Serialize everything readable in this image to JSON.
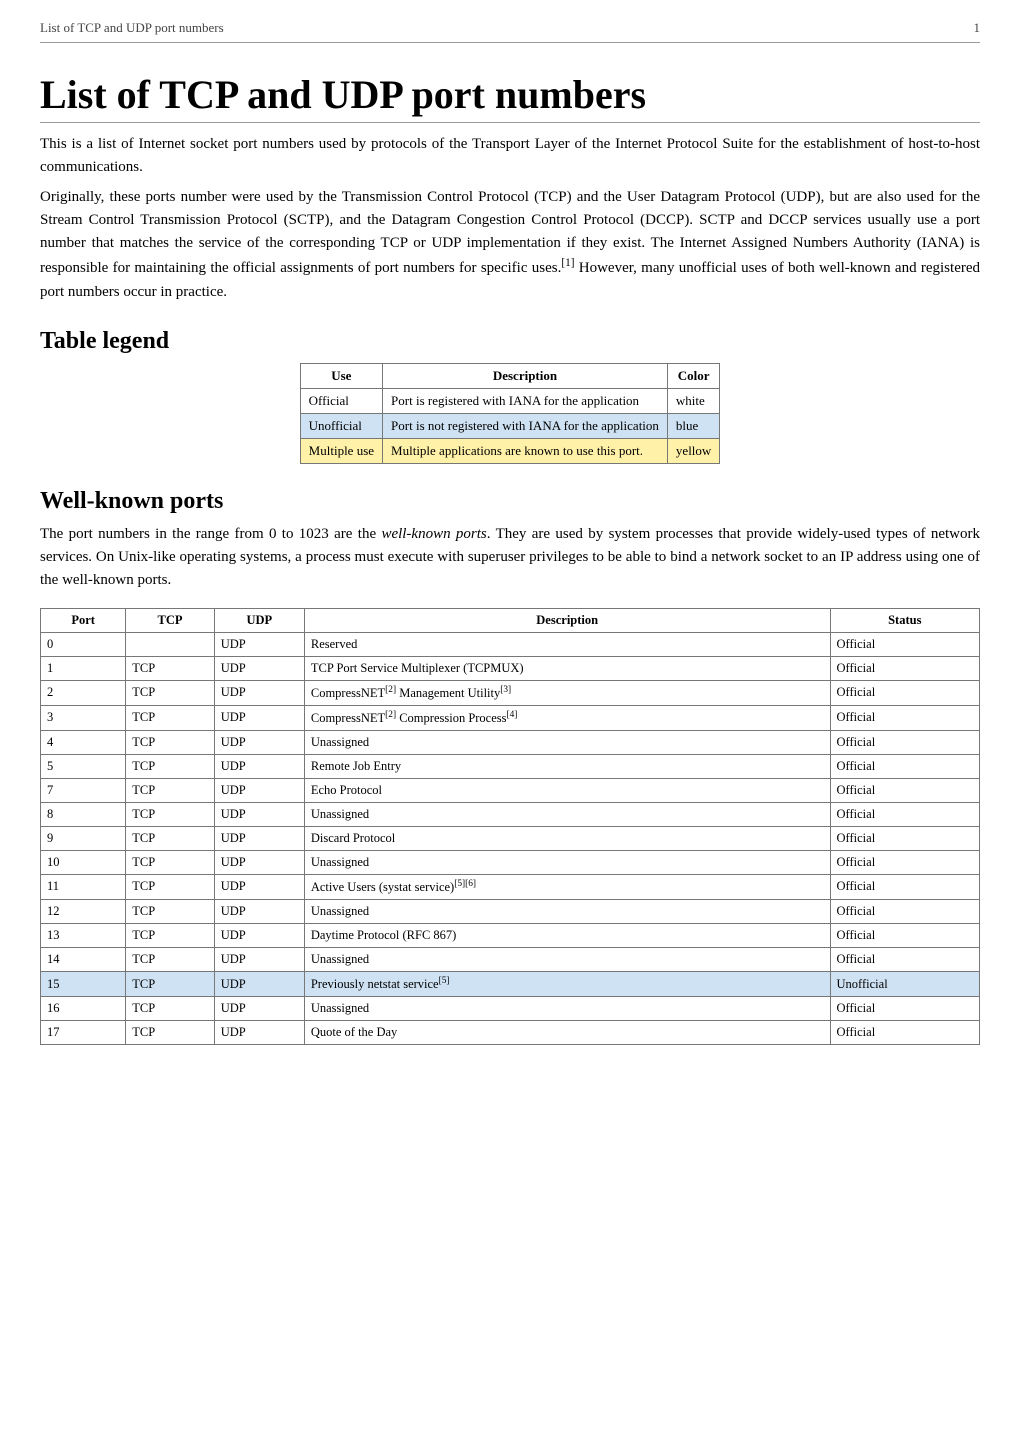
{
  "header": {
    "left": "List of TCP and UDP port numbers",
    "right": "1"
  },
  "title": "List of TCP and UDP port numbers",
  "intro": {
    "p1": "This is a list of Internet socket port numbers used by protocols of the Transport Layer of the Internet Protocol Suite for the establishment of host-to-host communications.",
    "p2_a": "Originally, these ports number were used by the Transmission Control Protocol (TCP) and the User Datagram Protocol (UDP), but are also used for the Stream Control Transmission Protocol (SCTP), and the Datagram Congestion Control Protocol (DCCP). SCTP and DCCP services usually use a port number that matches the service of the corresponding TCP or UDP implementation if they exist. The Internet Assigned Numbers Authority (IANA) is responsible for maintaining the official assignments of port numbers for specific uses.",
    "p2_sup": "[1]",
    "p2_b": " However, many unofficial uses of both well-known and registered port numbers occur in practice."
  },
  "legend": {
    "heading": "Table legend",
    "cols": {
      "use": "Use",
      "desc": "Description",
      "color": "Color"
    },
    "rows": [
      {
        "use": "Official",
        "desc": "Port is registered with IANA for the application",
        "color": "white",
        "rowclass": "row-white"
      },
      {
        "use": "Unofficial",
        "desc": "Port is not registered with IANA for the application",
        "color": "blue",
        "rowclass": "row-blue"
      },
      {
        "use": "Multiple use",
        "desc": "Multiple applications are known to use this port.",
        "color": "yellow",
        "rowclass": "row-yellow"
      }
    ]
  },
  "wellknown": {
    "heading": "Well-known ports",
    "text_a": "The port numbers in the range from 0 to 1023 are the ",
    "text_italic": "well-known ports",
    "text_b": ". They are used by system processes that provide widely-used types of network services. On Unix-like operating systems, a process must execute with superuser privileges to be able to bind a network socket to an IP address using one of the well-known ports.",
    "cols": {
      "port": "Port",
      "tcp": "TCP",
      "udp": "UDP",
      "desc": "Description",
      "status": "Status"
    },
    "rows": [
      {
        "port": "0",
        "tcp": "",
        "udp": "UDP",
        "desc": "Reserved",
        "sup": "",
        "status": "Official",
        "rowclass": "row-white"
      },
      {
        "port": "1",
        "tcp": "TCP",
        "udp": "UDP",
        "desc": "TCP Port Service Multiplexer (TCPMUX)",
        "sup": "",
        "status": "Official",
        "rowclass": "row-white"
      },
      {
        "port": "2",
        "tcp": "TCP",
        "udp": "UDP",
        "desc": "CompressNET",
        "sup": "[2]",
        "desc2": " Management Utility",
        "sup2": "[3]",
        "status": "Official",
        "rowclass": "row-white"
      },
      {
        "port": "3",
        "tcp": "TCP",
        "udp": "UDP",
        "desc": "CompressNET",
        "sup": "[2]",
        "desc2": " Compression Process",
        "sup2": "[4]",
        "status": "Official",
        "rowclass": "row-white"
      },
      {
        "port": "4",
        "tcp": "TCP",
        "udp": "UDP",
        "desc": "Unassigned",
        "sup": "",
        "status": "Official",
        "rowclass": "row-white"
      },
      {
        "port": "5",
        "tcp": "TCP",
        "udp": "UDP",
        "desc": "Remote Job Entry",
        "sup": "",
        "status": "Official",
        "rowclass": "row-white"
      },
      {
        "port": "7",
        "tcp": "TCP",
        "udp": "UDP",
        "desc": "Echo Protocol",
        "sup": "",
        "status": "Official",
        "rowclass": "row-white"
      },
      {
        "port": "8",
        "tcp": "TCP",
        "udp": "UDP",
        "desc": "Unassigned",
        "sup": "",
        "status": "Official",
        "rowclass": "row-white"
      },
      {
        "port": "9",
        "tcp": "TCP",
        "udp": "UDP",
        "desc": "Discard Protocol",
        "sup": "",
        "status": "Official",
        "rowclass": "row-white"
      },
      {
        "port": "10",
        "tcp": "TCP",
        "udp": "UDP",
        "desc": "Unassigned",
        "sup": "",
        "status": "Official",
        "rowclass": "row-white"
      },
      {
        "port": "11",
        "tcp": "TCP",
        "udp": "UDP",
        "desc": "Active Users (systat service)",
        "sup": "[5][6]",
        "status": "Official",
        "rowclass": "row-white"
      },
      {
        "port": "12",
        "tcp": "TCP",
        "udp": "UDP",
        "desc": "Unassigned",
        "sup": "",
        "status": "Official",
        "rowclass": "row-white"
      },
      {
        "port": "13",
        "tcp": "TCP",
        "udp": "UDP",
        "desc": "Daytime Protocol (RFC 867)",
        "sup": "",
        "status": "Official",
        "rowclass": "row-white"
      },
      {
        "port": "14",
        "tcp": "TCP",
        "udp": "UDP",
        "desc": "Unassigned",
        "sup": "",
        "status": "Official",
        "rowclass": "row-white"
      },
      {
        "port": "15",
        "tcp": "TCP",
        "udp": "UDP",
        "desc": "Previously netstat service",
        "sup": "[5]",
        "status": "Unofficial",
        "rowclass": "row-blue"
      },
      {
        "port": "16",
        "tcp": "TCP",
        "udp": "UDP",
        "desc": "Unassigned",
        "sup": "",
        "status": "Official",
        "rowclass": "row-white"
      },
      {
        "port": "17",
        "tcp": "TCP",
        "udp": "UDP",
        "desc": "Quote of the Day",
        "sup": "",
        "status": "Official",
        "rowclass": "row-white"
      }
    ]
  }
}
